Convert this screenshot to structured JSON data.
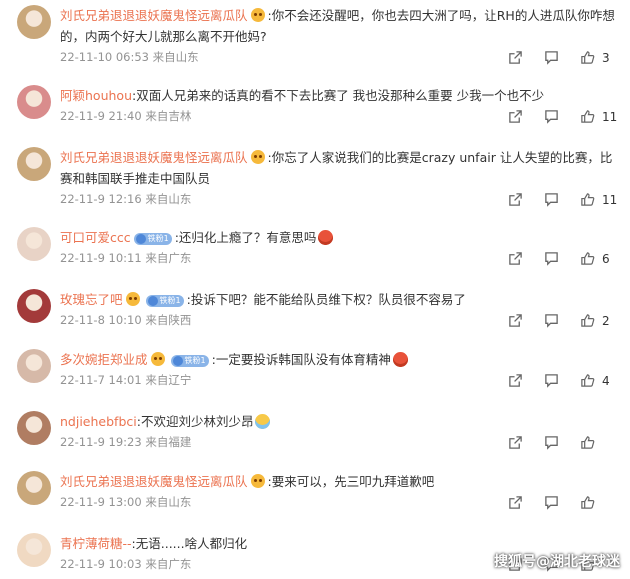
{
  "comments": [
    {
      "user": "刘氏兄弟退退退妖魔鬼怪远离瓜队",
      "emoji": true,
      "fan": "",
      "text": ":你不会还没醒吧，你也去四大洲了吗，让RH的人进瓜队你咋想的，内两个好大儿就那么离不开他妈?",
      "tail": "",
      "date": "22-11-10 06:53",
      "loc": "来自山东",
      "likes": "3"
    },
    {
      "user": "阿颖houhou",
      "emoji": false,
      "fan": "",
      "text": ":双面人兄弟来的话真的看不下去比赛了 我也没那种么重要 少我一个也不少",
      "tail": "",
      "date": "22-11-9 21:40",
      "loc": "来自吉林",
      "likes": "11"
    },
    {
      "user": "刘氏兄弟退退退妖魔鬼怪远离瓜队",
      "emoji": true,
      "fan": "",
      "text": ":你忘了人家说我们的比赛是crazy unfair 让人失望的比赛，比赛和韩国联手推走中国队员",
      "tail": "",
      "date": "22-11-9 12:16",
      "loc": "来自山东",
      "likes": "11"
    },
    {
      "user": "可口可爱ccc",
      "emoji": false,
      "fan": "铁粉1",
      "text": ":还归化上瘾了？有意思吗",
      "tail": "angry",
      "date": "22-11-9 10:11",
      "loc": "来自广东",
      "likes": "6"
    },
    {
      "user": "玫瑰忘了吧",
      "emoji": true,
      "fan": "铁粉1",
      "text": ":投诉下吧？能不能给队员维下权？队员很不容易了",
      "tail": "",
      "date": "22-11-8 10:10",
      "loc": "来自陕西",
      "likes": "2"
    },
    {
      "user": "多次婉拒郑业成",
      "emoji": true,
      "fan": "铁粉1",
      "text": ":一定要投诉韩国队没有体育精神",
      "tail": "angry",
      "date": "22-11-7 14:01",
      "loc": "来自辽宁",
      "likes": "4"
    },
    {
      "user": "ndjiehebfbci",
      "emoji": false,
      "fan": "",
      "text": ":不欢迎刘少林刘少昂",
      "tail": "cry",
      "date": "22-11-9 19:23",
      "loc": "来自福建",
      "likes": ""
    },
    {
      "user": "刘氏兄弟退退退妖魔鬼怪远离瓜队",
      "emoji": true,
      "fan": "",
      "text": ":要来可以，先三叩九拜道歉吧",
      "tail": "",
      "date": "22-11-9 13:00",
      "loc": "来自山东",
      "likes": ""
    },
    {
      "user": "青柠薄荷糖--",
      "emoji": false,
      "fan": "",
      "text": ":无语......啥人都归化",
      "tail": "",
      "date": "22-11-9 10:03",
      "loc": "来自广东",
      "likes": ""
    }
  ],
  "watermark": "搜狐号@湖北老球迷",
  "colors": {
    "username": "#eb7350",
    "meta": "#939393"
  }
}
